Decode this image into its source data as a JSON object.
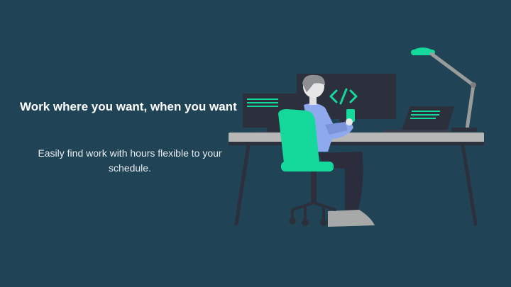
{
  "slide": {
    "headline": "Work where you want, when you want",
    "subtitle": "Easily find work with hours flexible to your schedule."
  },
  "colors": {
    "background": "#204355",
    "accent": "#14d99a",
    "desk": "#b6b7b6",
    "monitor": "#2c2f3c",
    "shirt": "#8fa9ee",
    "pants": "#2b2d3c"
  },
  "illustration": {
    "code_symbol": "</>"
  },
  "icons": [
    "desk-lamp-icon",
    "code-icon",
    "office-chair-icon",
    "laptop-icon",
    "monitor-icon"
  ]
}
